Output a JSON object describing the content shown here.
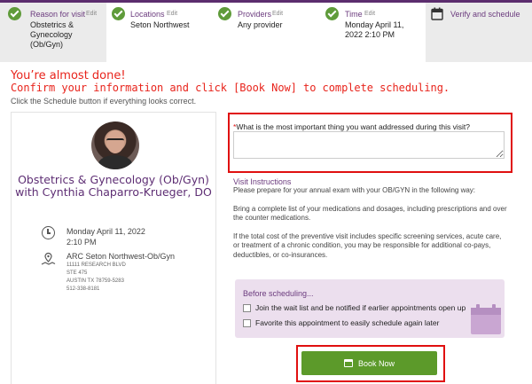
{
  "stepper": {
    "steps": [
      {
        "label": "Reason for visit",
        "edit": "Edit",
        "value": "Obstetrics & Gynecology (Ob/Gyn)"
      },
      {
        "label": "Locations",
        "edit": "Edit",
        "value": "Seton Northwest"
      },
      {
        "label": "Providers",
        "edit": "Edit",
        "value": "Any provider"
      },
      {
        "label": "Time",
        "edit": "Edit",
        "value": "Monday April 11, 2022 2:10 PM"
      }
    ],
    "current": {
      "label": "Verify and schedule"
    }
  },
  "header": {
    "headline": "You’re almost done!",
    "instruction": "Confirm your information and click [Book Now] to complete scheduling.",
    "subtext": "Click the Schedule button if everything looks correct."
  },
  "provider": {
    "title": "Obstetrics & Gynecology (Ob/Gyn) with Cynthia Chaparro-Krueger, DO",
    "date": "Monday April 11, 2022",
    "time": "2:10 PM",
    "location_name": "ARC Seton Northwest-Ob/Gyn",
    "address": [
      "11111 RESEARCH BLVD",
      "STE 475",
      "AUSTIN TX 78759-5283",
      "512-338-8181"
    ]
  },
  "question": {
    "required_mark": "*",
    "label": "What is the most important thing you want addressed during this visit?",
    "value": ""
  },
  "visit_instructions": {
    "title": "Visit Instructions",
    "paragraphs": [
      "Please prepare for your annual exam with your OB/GYN in the following way:",
      "Bring a complete list of your medications and dosages, including prescriptions and over the counter medications.",
      "If the total cost of the preventive visit includes specific screening services, acute care, or treatment of a chronic condition, you may be responsible for additional co-pays, deductibles, or co-insurances."
    ]
  },
  "before_scheduling": {
    "title": "Before scheduling...",
    "options": [
      {
        "label": "Join the wait list and be notified if earlier appointments open up",
        "checked": false
      },
      {
        "label": "Favorite this appointment to easily schedule again later",
        "checked": false
      }
    ]
  },
  "book_button": {
    "label": "Book Now"
  },
  "colors": {
    "accent_purple": "#6b3b7e",
    "success_green": "#5f9b3a",
    "alert_red": "#e8241c",
    "button_green": "#5c9a2a"
  }
}
